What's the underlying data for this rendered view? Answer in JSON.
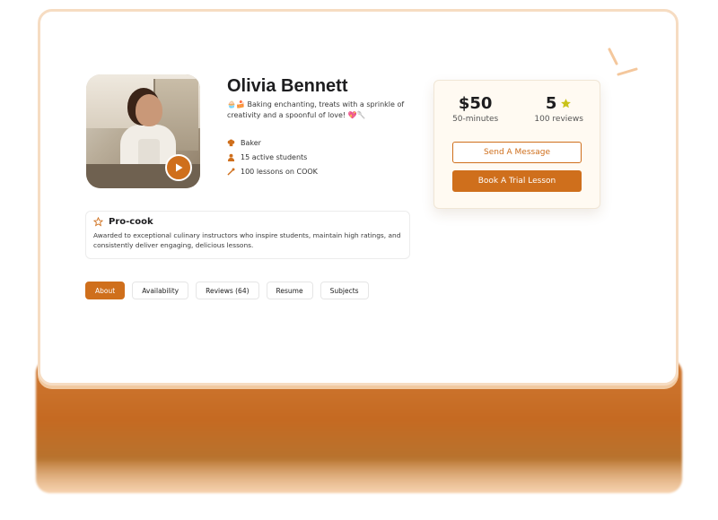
{
  "profile": {
    "name": "Olivia Bennett",
    "bio_emoji_start": "🧁🍰",
    "bio": "Baking enchanting, treats with a sprinkle of creativity and a spoonful of love!",
    "bio_emoji_end": "💖🥄",
    "facts": [
      {
        "icon": "chef-hat-icon",
        "label": "Baker"
      },
      {
        "icon": "person-icon",
        "label": "15 active students"
      },
      {
        "icon": "lessons-icon",
        "label": "100 lessons on COOK"
      }
    ]
  },
  "video": {
    "icon": "play-icon"
  },
  "badge": {
    "icon": "star-outline-icon",
    "title": "Pro-cook",
    "description": "Awarded to exceptional culinary instructors who inspire students, maintain high ratings, and consistently deliver engaging, delicious lessons."
  },
  "tabs": [
    {
      "label": "About",
      "active": true
    },
    {
      "label": "Availability",
      "active": false
    },
    {
      "label": "Reviews (64)",
      "active": false
    },
    {
      "label": "Resume",
      "active": false
    },
    {
      "label": "Subjects",
      "active": false
    }
  ],
  "pricing": {
    "price": "$50",
    "duration": "50-minutes",
    "rating": "5",
    "rating_icon": "star-icon",
    "reviews": "100 reviews",
    "message_button": "Send A Message",
    "trial_button": "Book A Trial Lesson"
  },
  "colors": {
    "accent": "#cf6f1c",
    "star": "#c9c21a",
    "card_border": "#f6dcc2"
  }
}
